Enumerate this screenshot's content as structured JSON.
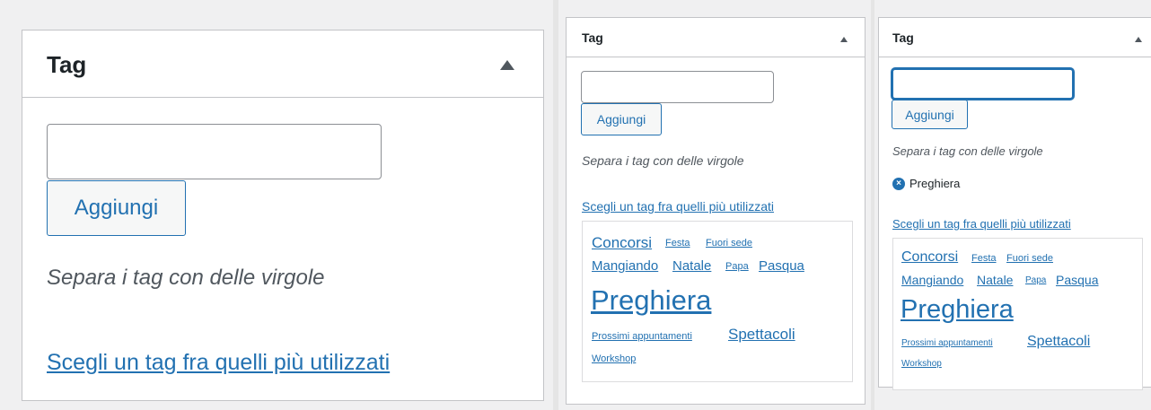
{
  "panels": [
    {
      "title": "Tag",
      "input_value": "",
      "add_button_label": "Aggiungi",
      "howto": "Separa i tag con delle virgole",
      "choose_link": "Scegli un tag fra quelli più utilizzati"
    },
    {
      "title": "Tag",
      "input_value": "",
      "add_button_label": "Aggiungi",
      "howto": "Separa i tag con delle virgole",
      "choose_link": "Scegli un tag fra quelli più utilizzati",
      "tag_cloud": [
        "Concorsi",
        "Festa",
        "Fuori sede",
        "Mangiando",
        "Natale",
        "Papa",
        "Pasqua",
        "Preghiera",
        "Prossimi appuntamenti",
        "Spettacoli",
        "Workshop"
      ]
    },
    {
      "title": "Tag",
      "input_value": "",
      "add_button_label": "Aggiungi",
      "howto": "Separa i tag con delle virgole",
      "chosen_tags": [
        {
          "label": "Preghiera",
          "remove_icon": "remove-circle-x-icon"
        }
      ],
      "choose_link": "Scegli un tag fra quelli più utilizzati",
      "tag_cloud": [
        "Concorsi",
        "Festa",
        "Fuori sede",
        "Mangiando",
        "Natale",
        "Papa",
        "Pasqua",
        "Preghiera",
        "Prossimi appuntamenti",
        "Spettacoli",
        "Workshop"
      ]
    }
  ],
  "colors": {
    "link": "#2271b1",
    "border": "#c3c4c7",
    "background": "#f0f0f1"
  }
}
